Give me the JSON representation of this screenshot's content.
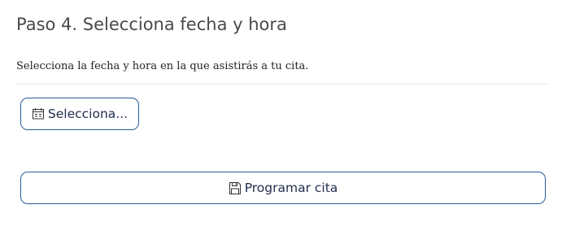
{
  "step": {
    "title": "Paso 4. Selecciona fecha y hora",
    "description": "Selecciona la fecha y hora en la que asistirás a tu cita."
  },
  "date_picker": {
    "label": "Selecciona...",
    "icon": "calendar-icon"
  },
  "submit": {
    "label": "Programar cita",
    "icon": "save-icon"
  },
  "colors": {
    "button_border": "#2b5aa0",
    "button_text": "#1f2c4d",
    "title_text": "#4a4a4a"
  }
}
